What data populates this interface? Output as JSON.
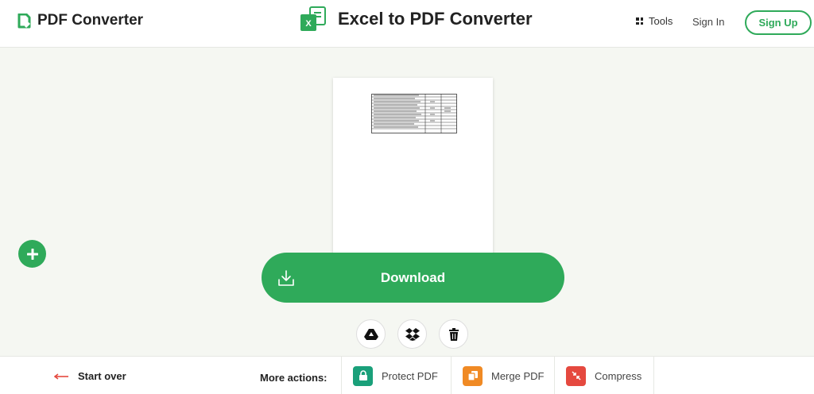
{
  "header": {
    "logo_text": "PDF Converter",
    "page_title": "Excel to PDF Converter",
    "tools_label": "Tools",
    "signin_label": "Sign In",
    "signup_label": "Sign Up",
    "excel_icon_letter": "X"
  },
  "main": {
    "download_label": "Download",
    "add_icon": "plus-icon",
    "actions": [
      "google-drive-icon",
      "dropbox-icon",
      "trash-icon"
    ]
  },
  "footer": {
    "start_over_label": "Start over",
    "more_actions_label": "More actions:",
    "actions": [
      {
        "label": "Protect PDF",
        "icon": "lock-icon",
        "color": "#1aa07a"
      },
      {
        "label": "Merge PDF",
        "icon": "merge-icon",
        "color": "#f08a24"
      },
      {
        "label": "Compress",
        "icon": "compress-icon",
        "color": "#e5493f"
      }
    ]
  },
  "colors": {
    "brand_green": "#2faa5a",
    "background": "#f5f7f2",
    "start_over_arrow": "#e5493f"
  }
}
